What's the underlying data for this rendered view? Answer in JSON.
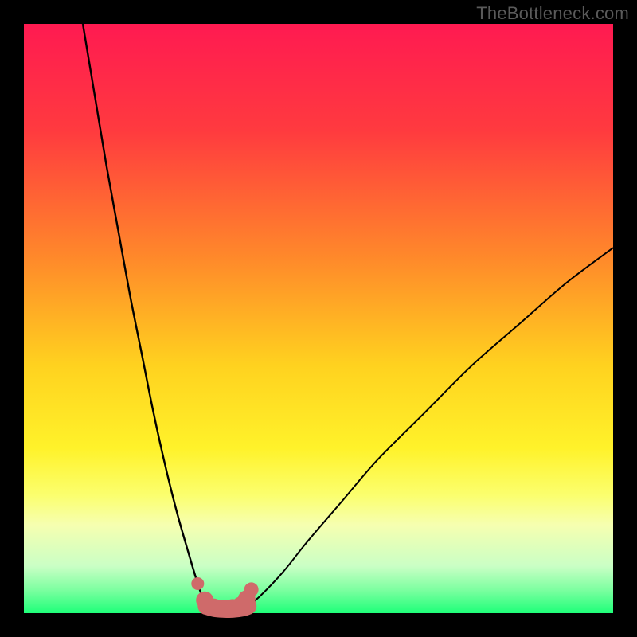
{
  "watermark": "TheBottleneck.com",
  "chart_data": {
    "type": "line",
    "title": "",
    "xlabel": "",
    "ylabel": "",
    "xlim": [
      0,
      100
    ],
    "ylim": [
      0,
      100
    ],
    "gradient_stops": [
      {
        "offset": 0,
        "color": "#ff1a51"
      },
      {
        "offset": 18,
        "color": "#ff3a3f"
      },
      {
        "offset": 40,
        "color": "#ff8a2a"
      },
      {
        "offset": 58,
        "color": "#ffd21f"
      },
      {
        "offset": 72,
        "color": "#fff22a"
      },
      {
        "offset": 80,
        "color": "#fbff6e"
      },
      {
        "offset": 85,
        "color": "#f6ffb0"
      },
      {
        "offset": 92,
        "color": "#caffc5"
      },
      {
        "offset": 96,
        "color": "#7effa1"
      },
      {
        "offset": 100,
        "color": "#1eff79"
      }
    ],
    "series": [
      {
        "name": "left-curve",
        "x": [
          10,
          12,
          14,
          16,
          18,
          20,
          22,
          24,
          26,
          28,
          29.5,
          30.5,
          31
        ],
        "y": [
          100,
          88,
          76,
          65,
          54,
          44,
          34,
          25,
          17,
          10,
          5,
          2.2,
          1.2
        ]
      },
      {
        "name": "right-curve",
        "x": [
          38,
          40,
          44,
          48,
          54,
          60,
          68,
          76,
          84,
          92,
          100
        ],
        "y": [
          1.2,
          2.8,
          7,
          12,
          19,
          26,
          34,
          42,
          49,
          56,
          62
        ]
      }
    ],
    "flat_bottom": {
      "x": [
        31,
        32.5,
        34,
        35.5,
        37,
        38
      ],
      "y": [
        1.2,
        0.8,
        0.7,
        0.7,
        0.9,
        1.2
      ]
    },
    "markers": {
      "color": "#cf6a6a",
      "radius_small": 8,
      "radius_large": 11,
      "points": [
        {
          "x": 29.5,
          "y": 5.0,
          "r": 8
        },
        {
          "x": 30.7,
          "y": 2.2,
          "r": 11
        },
        {
          "x": 32.2,
          "y": 1.0,
          "r": 11
        },
        {
          "x": 33.8,
          "y": 0.8,
          "r": 11
        },
        {
          "x": 35.4,
          "y": 0.9,
          "r": 11
        },
        {
          "x": 36.8,
          "y": 1.3,
          "r": 11
        },
        {
          "x": 37.8,
          "y": 2.4,
          "r": 11
        },
        {
          "x": 38.6,
          "y": 4.0,
          "r": 9
        }
      ]
    }
  }
}
